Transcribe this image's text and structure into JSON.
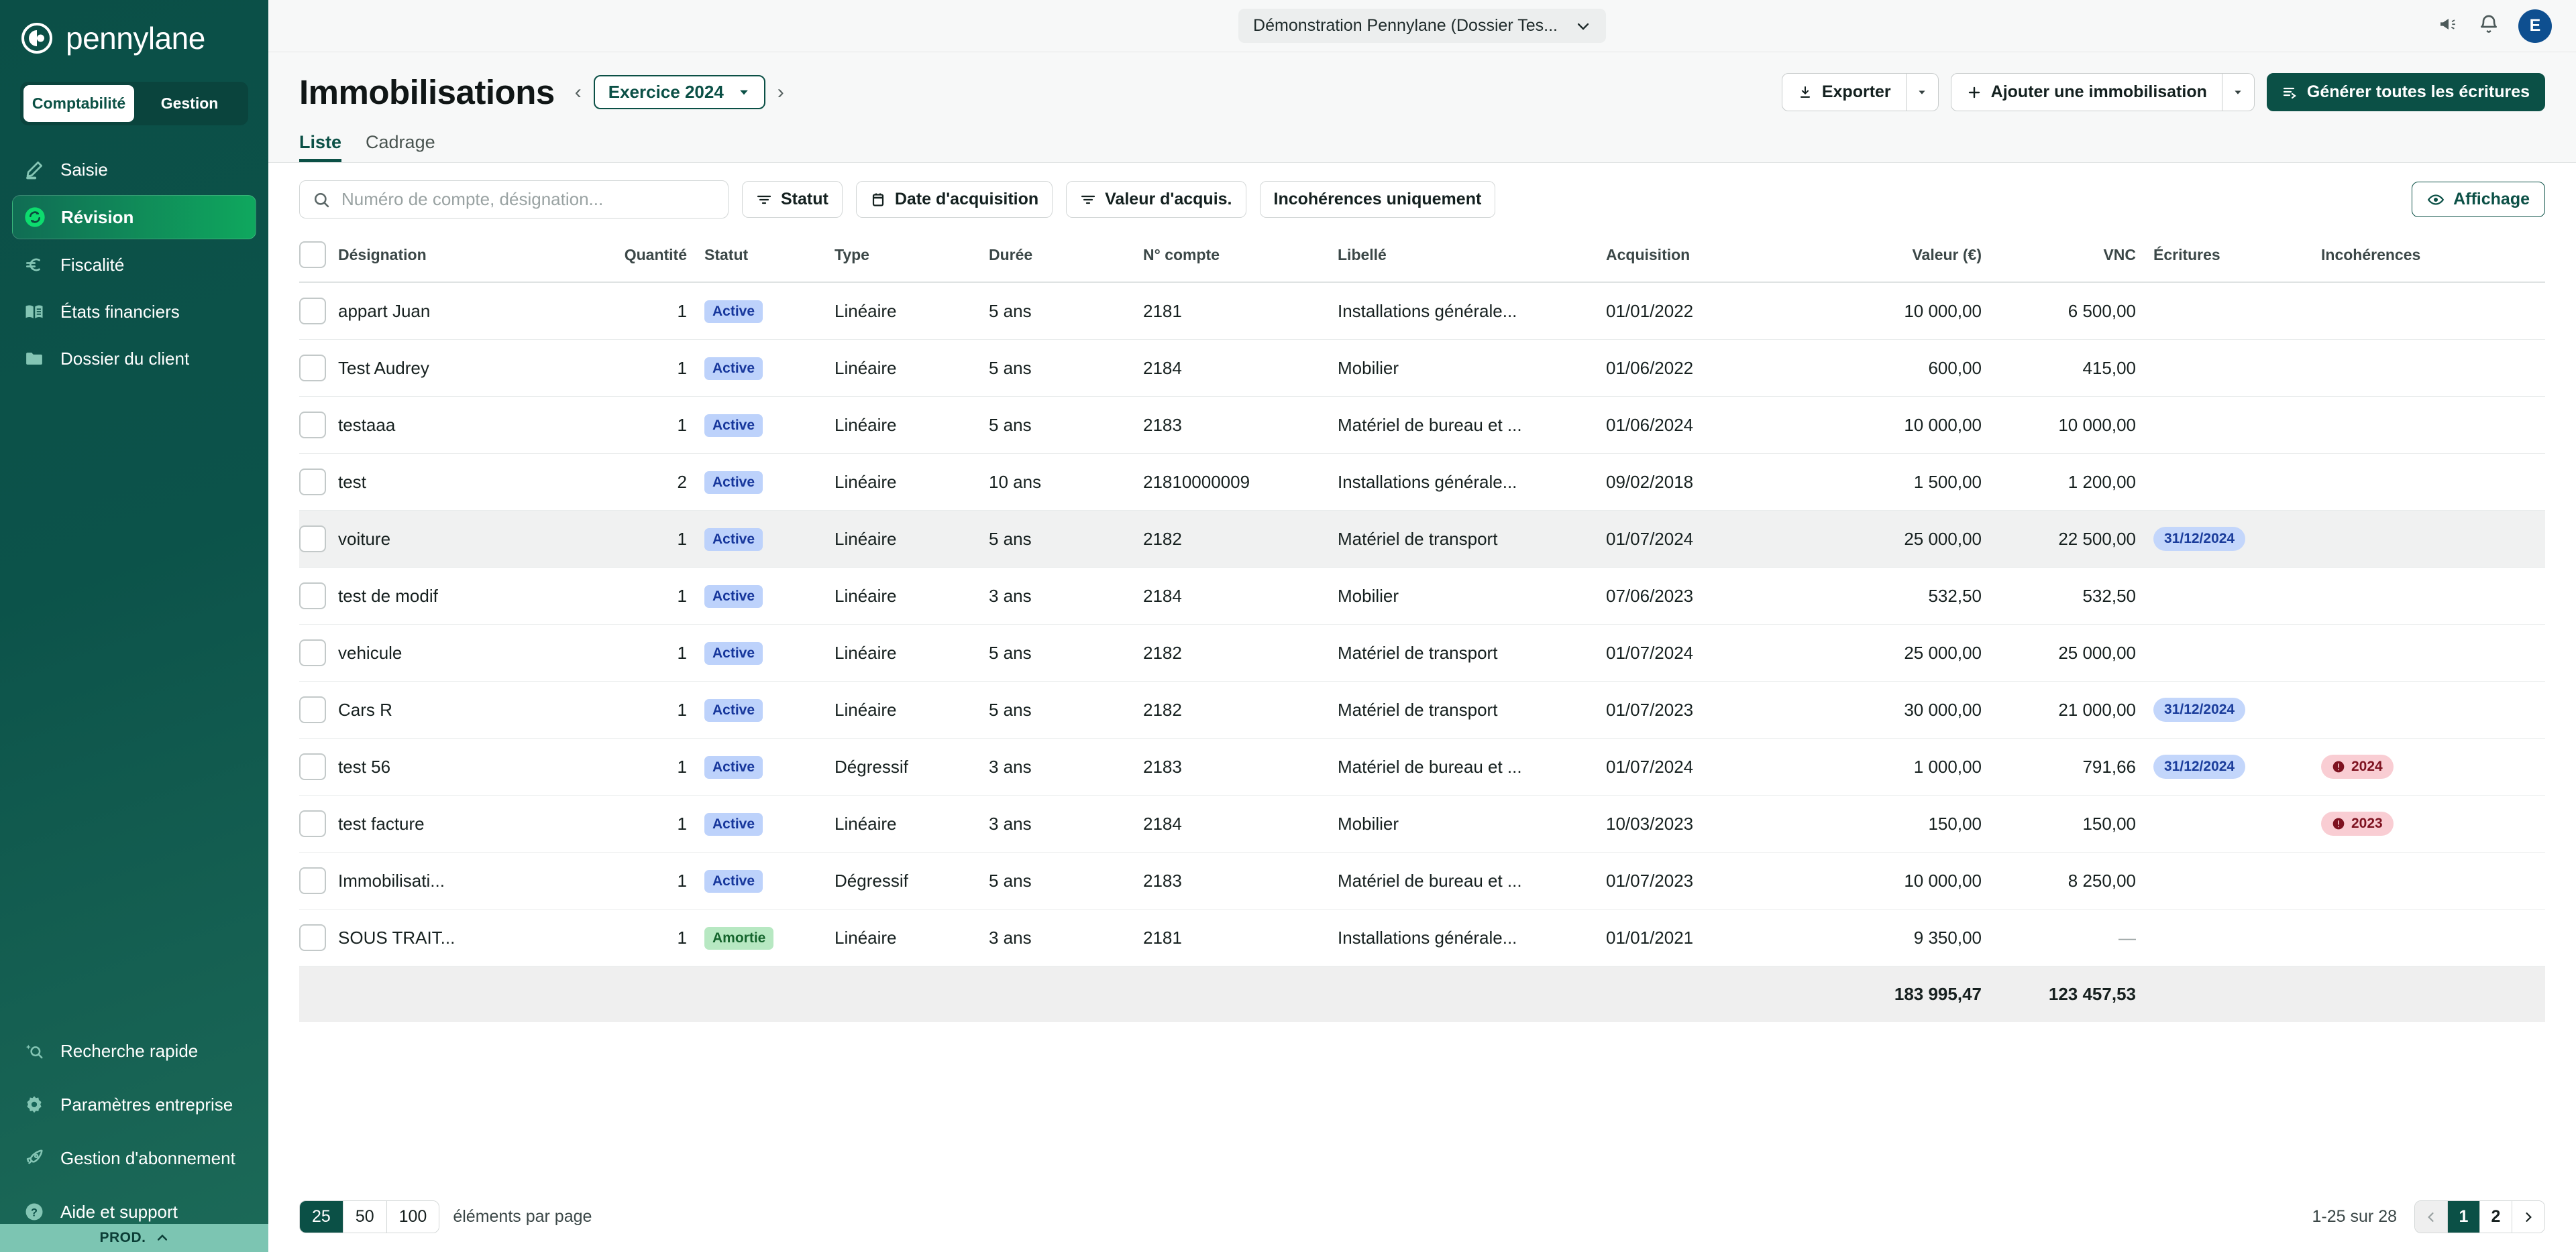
{
  "brand": {
    "name": "pennylane"
  },
  "segments": [
    {
      "label": "Comptabilité",
      "active": true
    },
    {
      "label": "Gestion",
      "active": false
    }
  ],
  "sidebar": {
    "items": [
      {
        "label": "Saisie",
        "icon": "pencil-icon",
        "active": false
      },
      {
        "label": "Révision",
        "icon": "refresh-icon",
        "active": true
      },
      {
        "label": "Fiscalité",
        "icon": "euro-icon",
        "active": false
      },
      {
        "label": "États financiers",
        "icon": "book-icon",
        "active": false
      },
      {
        "label": "Dossier du client",
        "icon": "folder-icon",
        "active": false
      }
    ],
    "bottom_items": [
      {
        "label": "Recherche rapide",
        "icon": "sparkle-search-icon"
      },
      {
        "label": "Paramètres entreprise",
        "icon": "gear-icon"
      },
      {
        "label": "Gestion d'abonnement",
        "icon": "rocket-icon"
      },
      {
        "label": "Aide et support",
        "icon": "help-circle-icon"
      }
    ],
    "env_label": "PROD."
  },
  "topbar": {
    "company": "Démonstration Pennylane (Dossier Tes...",
    "megaphone_icon": "megaphone-icon",
    "bell_icon": "bell-icon",
    "avatar_initial": "E"
  },
  "header": {
    "title": "Immobilisations",
    "fiscal_year": "Exercice 2024",
    "prev_arrow": "‹",
    "next_arrow": "›",
    "export_label": "Exporter",
    "add_label": "Ajouter une immobilisation",
    "generate_label": "Générer toutes les écritures"
  },
  "tabs": [
    {
      "label": "Liste",
      "active": true
    },
    {
      "label": "Cadrage",
      "active": false
    }
  ],
  "toolbar": {
    "search_placeholder": "Numéro de compte, désignation...",
    "filters": [
      {
        "label": "Statut",
        "icon": "filter-icon"
      },
      {
        "label": "Date d'acquisition",
        "icon": "calendar-icon"
      },
      {
        "label": "Valeur d'acquis.",
        "icon": "filter-icon"
      },
      {
        "label": "Incohérences uniquement",
        "icon": "none"
      }
    ],
    "display_label": "Affichage"
  },
  "table": {
    "columns": [
      "Désignation",
      "Quantité",
      "Statut",
      "Type",
      "Durée",
      "N° compte",
      "Libellé",
      "Acquisition",
      "Valeur (€)",
      "VNC",
      "Écritures",
      "Incohérences"
    ],
    "rows": [
      {
        "designation": "appart Juan",
        "quantite": "1",
        "statut": "Active",
        "type": "Linéaire",
        "duree": "5 ans",
        "compte": "2181",
        "libelle": "Installations générale...",
        "acquisition": "01/01/2022",
        "valeur": "10 000,00",
        "vnc": "6 500,00",
        "ecritures": "",
        "incoherences": "",
        "highlight": false
      },
      {
        "designation": "Test Audrey",
        "quantite": "1",
        "statut": "Active",
        "type": "Linéaire",
        "duree": "5 ans",
        "compte": "2184",
        "libelle": "Mobilier",
        "acquisition": "01/06/2022",
        "valeur": "600,00",
        "vnc": "415,00",
        "ecritures": "",
        "incoherences": "",
        "highlight": false
      },
      {
        "designation": "testaaa",
        "quantite": "1",
        "statut": "Active",
        "type": "Linéaire",
        "duree": "5 ans",
        "compte": "2183",
        "libelle": "Matériel de bureau et ...",
        "acquisition": "01/06/2024",
        "valeur": "10 000,00",
        "vnc": "10 000,00",
        "ecritures": "",
        "incoherences": "",
        "highlight": false
      },
      {
        "designation": "test",
        "quantite": "2",
        "statut": "Active",
        "type": "Linéaire",
        "duree": "10 ans",
        "compte": "21810000009",
        "libelle": "Installations générale...",
        "acquisition": "09/02/2018",
        "valeur": "1 500,00",
        "vnc": "1 200,00",
        "ecritures": "",
        "incoherences": "",
        "highlight": false
      },
      {
        "designation": "voiture",
        "quantite": "1",
        "statut": "Active",
        "type": "Linéaire",
        "duree": "5 ans",
        "compte": "2182",
        "libelle": "Matériel de transport",
        "acquisition": "01/07/2024",
        "valeur": "25 000,00",
        "vnc": "22 500,00",
        "ecritures": "31/12/2024",
        "incoherences": "",
        "highlight": true
      },
      {
        "designation": "test de modif",
        "quantite": "1",
        "statut": "Active",
        "type": "Linéaire",
        "duree": "3 ans",
        "compte": "2184",
        "libelle": "Mobilier",
        "acquisition": "07/06/2023",
        "valeur": "532,50",
        "vnc": "532,50",
        "ecritures": "",
        "incoherences": "",
        "highlight": false
      },
      {
        "designation": "vehicule",
        "quantite": "1",
        "statut": "Active",
        "type": "Linéaire",
        "duree": "5 ans",
        "compte": "2182",
        "libelle": "Matériel de transport",
        "acquisition": "01/07/2024",
        "valeur": "25 000,00",
        "vnc": "25 000,00",
        "ecritures": "",
        "incoherences": "",
        "highlight": false
      },
      {
        "designation": "Cars R",
        "quantite": "1",
        "statut": "Active",
        "type": "Linéaire",
        "duree": "5 ans",
        "compte": "2182",
        "libelle": "Matériel de transport",
        "acquisition": "01/07/2023",
        "valeur": "30 000,00",
        "vnc": "21 000,00",
        "ecritures": "31/12/2024",
        "incoherences": "",
        "highlight": false
      },
      {
        "designation": "test 56",
        "quantite": "1",
        "statut": "Active",
        "type": "Dégressif",
        "duree": "3 ans",
        "compte": "2183",
        "libelle": "Matériel de bureau et ...",
        "acquisition": "01/07/2024",
        "valeur": "1 000,00",
        "vnc": "791,66",
        "ecritures": "31/12/2024",
        "incoherences": "2024",
        "highlight": false
      },
      {
        "designation": "test facture",
        "quantite": "1",
        "statut": "Active",
        "type": "Linéaire",
        "duree": "3 ans",
        "compte": "2184",
        "libelle": "Mobilier",
        "acquisition": "10/03/2023",
        "valeur": "150,00",
        "vnc": "150,00",
        "ecritures": "",
        "incoherences": "2023",
        "highlight": false
      },
      {
        "designation": "Immobilisati...",
        "quantite": "1",
        "statut": "Active",
        "type": "Dégressif",
        "duree": "5 ans",
        "compte": "2183",
        "libelle": "Matériel de bureau et ...",
        "acquisition": "01/07/2023",
        "valeur": "10 000,00",
        "vnc": "8 250,00",
        "ecritures": "",
        "incoherences": "",
        "highlight": false
      },
      {
        "designation": "SOUS TRAIT...",
        "quantite": "1",
        "statut": "Amortie",
        "type": "Linéaire",
        "duree": "3 ans",
        "compte": "2181",
        "libelle": "Installations générale...",
        "acquisition": "01/01/2021",
        "valeur": "9 350,00",
        "vnc": "—",
        "ecritures": "",
        "incoherences": "",
        "highlight": false
      }
    ],
    "totals": {
      "valeur": "183 995,47",
      "vnc": "123 457,53"
    }
  },
  "footer": {
    "per_page_options": [
      "25",
      "50",
      "100"
    ],
    "per_page_selected": "25",
    "per_page_label": "éléments par page",
    "range_label": "1-25 sur 28",
    "pages": [
      "1",
      "2"
    ],
    "current_page": "1",
    "prev_icon": "chevron-left-icon",
    "next_icon": "chevron-right-icon"
  },
  "colors": {
    "brand_green": "#0b5046",
    "accent_green": "#0fa85e",
    "badge_blue": "#bdd2fb",
    "badge_green": "#b7e8c2",
    "badge_red": "#f9cdd3",
    "avatar_blue": "#0e4f90",
    "env_bar": "#7cc5b2"
  }
}
